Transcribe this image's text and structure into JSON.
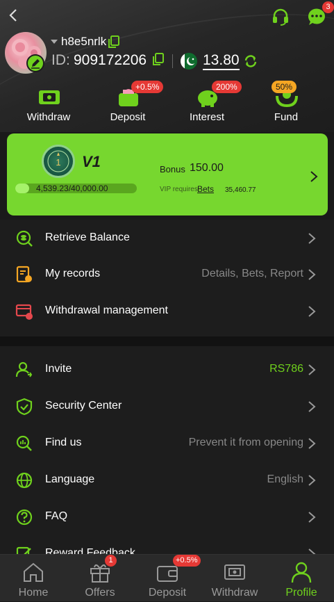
{
  "header": {
    "notification_count": "3",
    "username": "h8e5nrlk",
    "id_label": "ID:",
    "id_value": "909172206",
    "balance": "13.80"
  },
  "quick_actions": [
    {
      "label": "Withdraw",
      "badge": ""
    },
    {
      "label": "Deposit",
      "badge": "+0.5%"
    },
    {
      "label": "Interest",
      "badge": "200%"
    },
    {
      "label": "Fund",
      "badge": "50%"
    }
  ],
  "vip": {
    "level": "V1",
    "medal_number": "1",
    "progress_text": "4,539.23/40,000.00",
    "progress_fraction": 0.1135,
    "bonus_label": "Bonus",
    "bonus_value": "150.00",
    "requires_label": "VIP requires",
    "bets_label": "Bets",
    "bets_value": "35,460.77"
  },
  "menu1": [
    {
      "label": "Retrieve Balance",
      "right": ""
    },
    {
      "label": "My records",
      "right": "Details, Bets, Report"
    },
    {
      "label": "Withdrawal management",
      "right": ""
    }
  ],
  "menu2": [
    {
      "label": "Invite",
      "right": "RS786"
    },
    {
      "label": "Security Center",
      "right": ""
    },
    {
      "label": "Find us",
      "right": "Prevent it from opening"
    },
    {
      "label": "Language",
      "right": "English"
    },
    {
      "label": "FAQ",
      "right": ""
    },
    {
      "label": "Reward Feedback",
      "right": ""
    }
  ],
  "tabs": [
    {
      "label": "Home",
      "badge": ""
    },
    {
      "label": "Offers",
      "badge": "1"
    },
    {
      "label": "Deposit",
      "badge": "+0.5%"
    },
    {
      "label": "Withdraw",
      "badge": ""
    },
    {
      "label": "Profile",
      "badge": ""
    }
  ],
  "colors": {
    "accent": "#6fd11d",
    "vip_card": "#77d72f",
    "badge_red": "#e53935",
    "badge_orange": "#f5a623"
  }
}
